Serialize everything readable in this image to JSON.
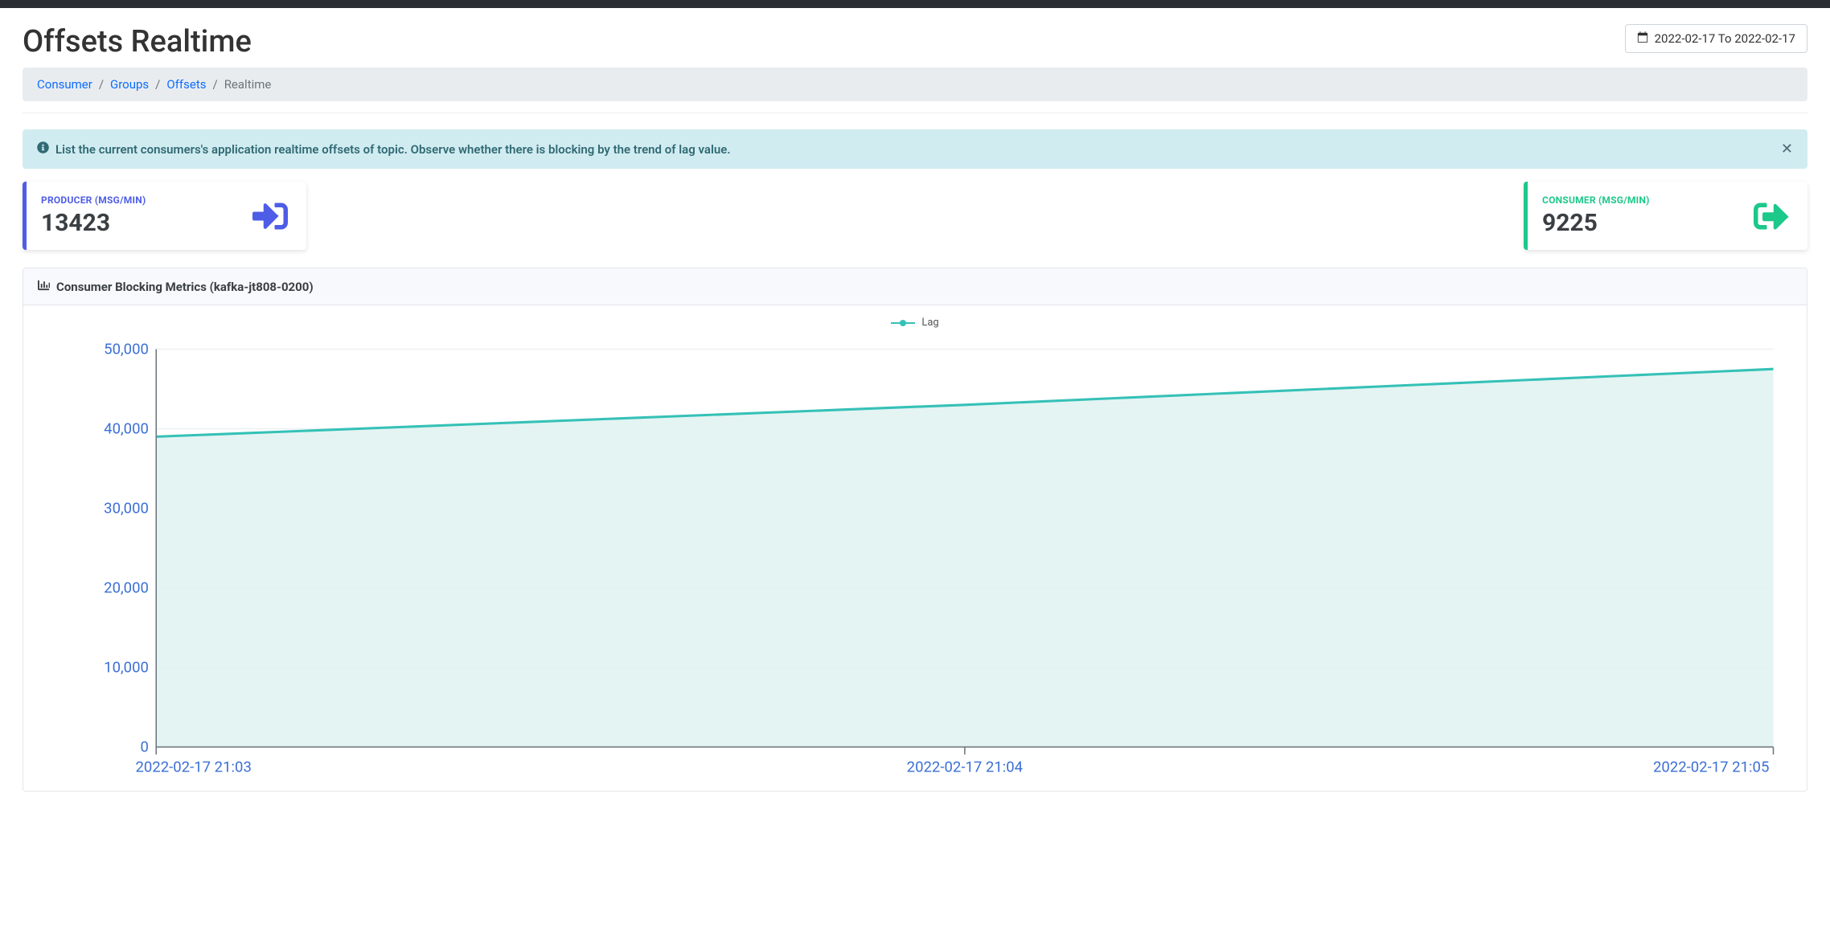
{
  "page": {
    "title": "Offsets Realtime",
    "date_range": "2022-02-17 To 2022-02-17"
  },
  "breadcrumb": {
    "items": [
      {
        "label": "Consumer",
        "link": true
      },
      {
        "label": "Groups",
        "link": true
      },
      {
        "label": "Offsets",
        "link": true
      },
      {
        "label": "Realtime",
        "link": false
      }
    ]
  },
  "alert": {
    "text": "List the current consumers's application realtime offsets of topic. Observe whether there is blocking by the trend of lag value."
  },
  "metrics": {
    "producer": {
      "label": "PRODUCER (MSG/MIN)",
      "value": "13423"
    },
    "consumer": {
      "label": "CONSUMER (MSG/MIN)",
      "value": "9225"
    }
  },
  "panel": {
    "title": "Consumer Blocking Metrics (kafka-jt808-0200)"
  },
  "chart_data": {
    "type": "area",
    "title": "",
    "xlabel": "",
    "ylabel": "",
    "ylim": [
      0,
      50000
    ],
    "y_ticks": [
      "0",
      "10,000",
      "20,000",
      "30,000",
      "40,000",
      "50,000"
    ],
    "x_ticks": [
      "2022-02-17 21:03",
      "2022-02-17 21:04",
      "2022-02-17 21:05"
    ],
    "series": [
      {
        "name": "Lag",
        "x": [
          "2022-02-17 21:03",
          "2022-02-17 21:04",
          "2022-02-17 21:05"
        ],
        "values": [
          39000,
          43000,
          47500
        ]
      }
    ]
  }
}
